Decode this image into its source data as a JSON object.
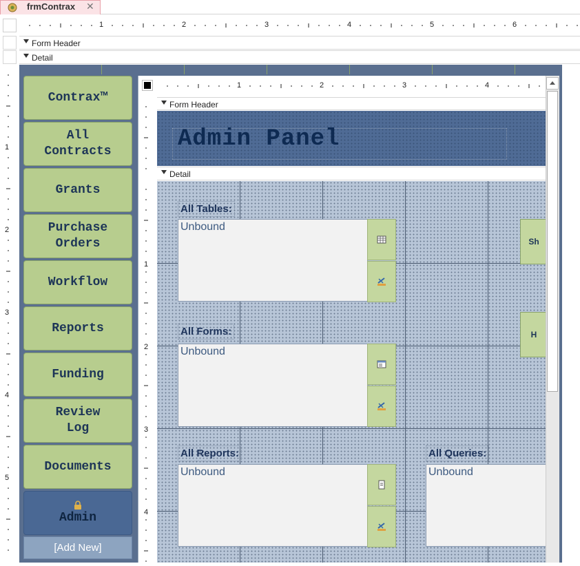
{
  "tab": {
    "title": "frmContrax",
    "close": "✕"
  },
  "outer_ruler": {
    "numbers": [
      "1",
      "2",
      "3",
      "4",
      "5",
      "6"
    ]
  },
  "outer_left_ruler": {
    "numbers": [
      "1",
      "2",
      "3",
      "4",
      "5"
    ]
  },
  "sections": {
    "form_header": "Form Header",
    "detail": "Detail"
  },
  "nav": {
    "contrax": "Contrax™",
    "all_contracts": "All\nContracts",
    "grants": "Grants",
    "purchase_orders": "Purchase\nOrders",
    "workflow": "Workflow",
    "reports": "Reports",
    "funding": "Funding",
    "review_log": "Review\nLog",
    "documents": "Documents",
    "admin": "Admin",
    "add_new": "[Add New]"
  },
  "subform": {
    "ruler_numbers": [
      "1",
      "2",
      "3",
      "4"
    ],
    "left_ruler_numbers": [
      "1",
      "2",
      "3",
      "4"
    ],
    "form_header": "Form Header",
    "detail": "Detail",
    "title": "Admin Panel",
    "tables_label": "All Tables:",
    "forms_label": "All Forms:",
    "reports_label": "All Reports:",
    "queries_label": "All Queries:",
    "unbound": "Unbound",
    "right_btn_1": "Sh",
    "right_btn_2": "H"
  },
  "colors": {
    "nav_green": "#b7cd8e",
    "admin_blue": "#4a6894",
    "header_blue": "#4f6b95",
    "detail_grid": "#b7c5d7"
  }
}
